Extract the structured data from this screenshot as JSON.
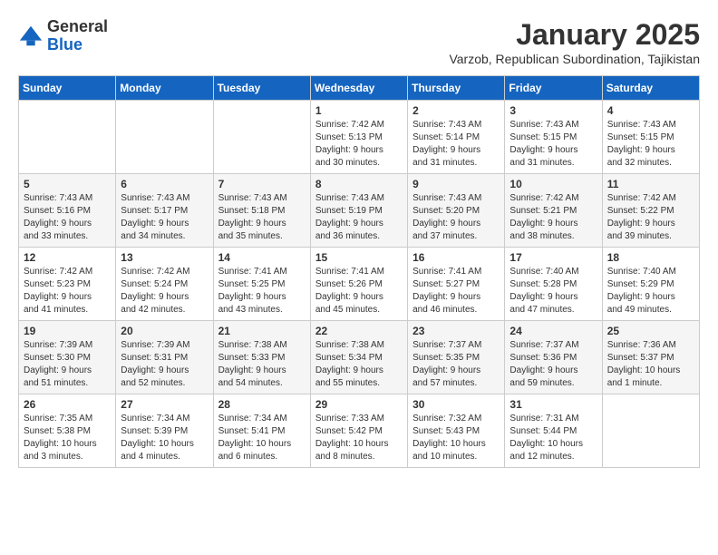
{
  "logo": {
    "general": "General",
    "blue": "Blue"
  },
  "header": {
    "month": "January 2025",
    "location": "Varzob, Republican Subordination, Tajikistan"
  },
  "weekdays": [
    "Sunday",
    "Monday",
    "Tuesday",
    "Wednesday",
    "Thursday",
    "Friday",
    "Saturday"
  ],
  "weeks": [
    [
      {
        "day": "",
        "info": ""
      },
      {
        "day": "",
        "info": ""
      },
      {
        "day": "",
        "info": ""
      },
      {
        "day": "1",
        "info": "Sunrise: 7:42 AM\nSunset: 5:13 PM\nDaylight: 9 hours\nand 30 minutes."
      },
      {
        "day": "2",
        "info": "Sunrise: 7:43 AM\nSunset: 5:14 PM\nDaylight: 9 hours\nand 31 minutes."
      },
      {
        "day": "3",
        "info": "Sunrise: 7:43 AM\nSunset: 5:15 PM\nDaylight: 9 hours\nand 31 minutes."
      },
      {
        "day": "4",
        "info": "Sunrise: 7:43 AM\nSunset: 5:15 PM\nDaylight: 9 hours\nand 32 minutes."
      }
    ],
    [
      {
        "day": "5",
        "info": "Sunrise: 7:43 AM\nSunset: 5:16 PM\nDaylight: 9 hours\nand 33 minutes."
      },
      {
        "day": "6",
        "info": "Sunrise: 7:43 AM\nSunset: 5:17 PM\nDaylight: 9 hours\nand 34 minutes."
      },
      {
        "day": "7",
        "info": "Sunrise: 7:43 AM\nSunset: 5:18 PM\nDaylight: 9 hours\nand 35 minutes."
      },
      {
        "day": "8",
        "info": "Sunrise: 7:43 AM\nSunset: 5:19 PM\nDaylight: 9 hours\nand 36 minutes."
      },
      {
        "day": "9",
        "info": "Sunrise: 7:43 AM\nSunset: 5:20 PM\nDaylight: 9 hours\nand 37 minutes."
      },
      {
        "day": "10",
        "info": "Sunrise: 7:42 AM\nSunset: 5:21 PM\nDaylight: 9 hours\nand 38 minutes."
      },
      {
        "day": "11",
        "info": "Sunrise: 7:42 AM\nSunset: 5:22 PM\nDaylight: 9 hours\nand 39 minutes."
      }
    ],
    [
      {
        "day": "12",
        "info": "Sunrise: 7:42 AM\nSunset: 5:23 PM\nDaylight: 9 hours\nand 41 minutes."
      },
      {
        "day": "13",
        "info": "Sunrise: 7:42 AM\nSunset: 5:24 PM\nDaylight: 9 hours\nand 42 minutes."
      },
      {
        "day": "14",
        "info": "Sunrise: 7:41 AM\nSunset: 5:25 PM\nDaylight: 9 hours\nand 43 minutes."
      },
      {
        "day": "15",
        "info": "Sunrise: 7:41 AM\nSunset: 5:26 PM\nDaylight: 9 hours\nand 45 minutes."
      },
      {
        "day": "16",
        "info": "Sunrise: 7:41 AM\nSunset: 5:27 PM\nDaylight: 9 hours\nand 46 minutes."
      },
      {
        "day": "17",
        "info": "Sunrise: 7:40 AM\nSunset: 5:28 PM\nDaylight: 9 hours\nand 47 minutes."
      },
      {
        "day": "18",
        "info": "Sunrise: 7:40 AM\nSunset: 5:29 PM\nDaylight: 9 hours\nand 49 minutes."
      }
    ],
    [
      {
        "day": "19",
        "info": "Sunrise: 7:39 AM\nSunset: 5:30 PM\nDaylight: 9 hours\nand 51 minutes."
      },
      {
        "day": "20",
        "info": "Sunrise: 7:39 AM\nSunset: 5:31 PM\nDaylight: 9 hours\nand 52 minutes."
      },
      {
        "day": "21",
        "info": "Sunrise: 7:38 AM\nSunset: 5:33 PM\nDaylight: 9 hours\nand 54 minutes."
      },
      {
        "day": "22",
        "info": "Sunrise: 7:38 AM\nSunset: 5:34 PM\nDaylight: 9 hours\nand 55 minutes."
      },
      {
        "day": "23",
        "info": "Sunrise: 7:37 AM\nSunset: 5:35 PM\nDaylight: 9 hours\nand 57 minutes."
      },
      {
        "day": "24",
        "info": "Sunrise: 7:37 AM\nSunset: 5:36 PM\nDaylight: 9 hours\nand 59 minutes."
      },
      {
        "day": "25",
        "info": "Sunrise: 7:36 AM\nSunset: 5:37 PM\nDaylight: 10 hours\nand 1 minute."
      }
    ],
    [
      {
        "day": "26",
        "info": "Sunrise: 7:35 AM\nSunset: 5:38 PM\nDaylight: 10 hours\nand 3 minutes."
      },
      {
        "day": "27",
        "info": "Sunrise: 7:34 AM\nSunset: 5:39 PM\nDaylight: 10 hours\nand 4 minutes."
      },
      {
        "day": "28",
        "info": "Sunrise: 7:34 AM\nSunset: 5:41 PM\nDaylight: 10 hours\nand 6 minutes."
      },
      {
        "day": "29",
        "info": "Sunrise: 7:33 AM\nSunset: 5:42 PM\nDaylight: 10 hours\nand 8 minutes."
      },
      {
        "day": "30",
        "info": "Sunrise: 7:32 AM\nSunset: 5:43 PM\nDaylight: 10 hours\nand 10 minutes."
      },
      {
        "day": "31",
        "info": "Sunrise: 7:31 AM\nSunset: 5:44 PM\nDaylight: 10 hours\nand 12 minutes."
      },
      {
        "day": "",
        "info": ""
      }
    ]
  ]
}
